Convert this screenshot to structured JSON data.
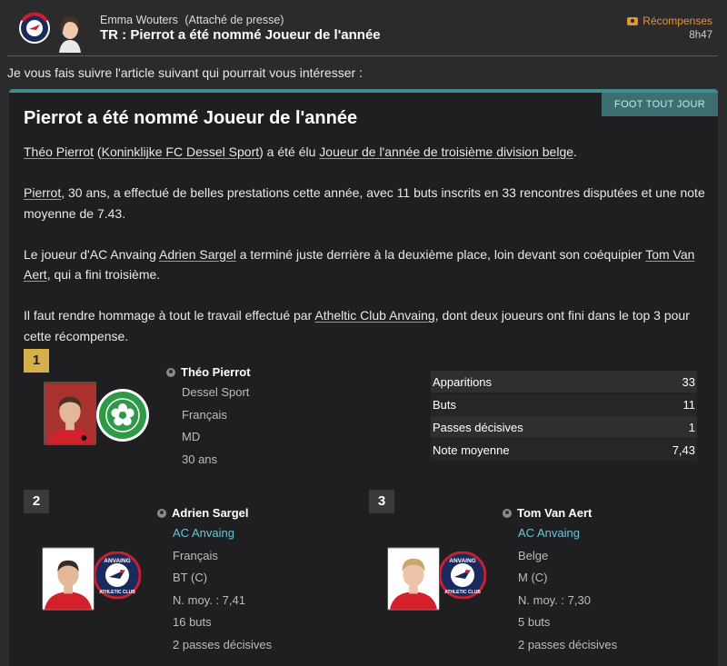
{
  "header": {
    "sender_name": "Emma Wouters",
    "sender_role": "(Attaché de presse)",
    "subject": "TR : Pierrot a été nommé Joueur de l'année",
    "reward_label": "Récompenses",
    "time": "8h47"
  },
  "intro": "Je vous fais suivre l'article suivant qui pourrait vous intéresser :",
  "article": {
    "source": "FOOT TOUT JOUR",
    "headline": "Pierrot a été nommé Joueur de l'année",
    "p1": {
      "player": "Théo Pierrot",
      "club": "Koninklijke FC Dessel Sport",
      "a": " (",
      "b": ") a été élu ",
      "award": "Joueur de l'année de troisième division belge",
      "c": "."
    },
    "p2": {
      "player": "Pierrot",
      "text": ", 30 ans, a effectué de belles prestations cette année, avec 11 buts inscrits en 33 rencontres disputées et une note moyenne de 7.43."
    },
    "p3": {
      "a": "Le joueur d'AC Anvaing ",
      "player1": "Adrien Sargel",
      "b": " a terminé juste derrière à la deuxième place, loin devant son coéquipier ",
      "player2": "Tom Van Aert",
      "c": ", qui a fini troisième."
    },
    "p4": {
      "a": "Il faut rendre hommage à tout le travail effectué par ",
      "club": "Atheltic Club Anvaing",
      "b": ", dont deux joueurs ont fini dans le top 3 pour cette récompense."
    }
  },
  "winners": [
    {
      "rank": "1",
      "name": "Théo Pierrot",
      "club": "Dessel Sport",
      "nationality": "Français",
      "position": "MD",
      "age": "30 ans",
      "stats": [
        {
          "label": "Apparitions",
          "value": "33"
        },
        {
          "label": "Buts",
          "value": "11"
        },
        {
          "label": "Passes décisives",
          "value": "1"
        },
        {
          "label": "Note moyenne",
          "value": "7,43"
        }
      ]
    },
    {
      "rank": "2",
      "name": "Adrien Sargel",
      "club": "AC Anvaing",
      "nationality": "Français",
      "position": "BT (C)",
      "rating": "N. moy. : 7,41",
      "goals": "16 buts",
      "assists": "2 passes décisives"
    },
    {
      "rank": "3",
      "name": "Tom Van Aert",
      "club": "AC Anvaing",
      "nationality": "Belge",
      "position": "M (C)",
      "rating": "N. moy. : 7,30",
      "goals": "5 buts",
      "assists": "2 passes décisives"
    }
  ],
  "badge_text": {
    "anvaing_top": "ANVAING",
    "anvaing_bottom": "ATHLETIC CLUB"
  },
  "colors": {
    "accent_teal": "#3f8b8e",
    "reward_orange": "#e0953a",
    "gold": "#d6b14a",
    "link_blue": "#6ec2d4"
  }
}
